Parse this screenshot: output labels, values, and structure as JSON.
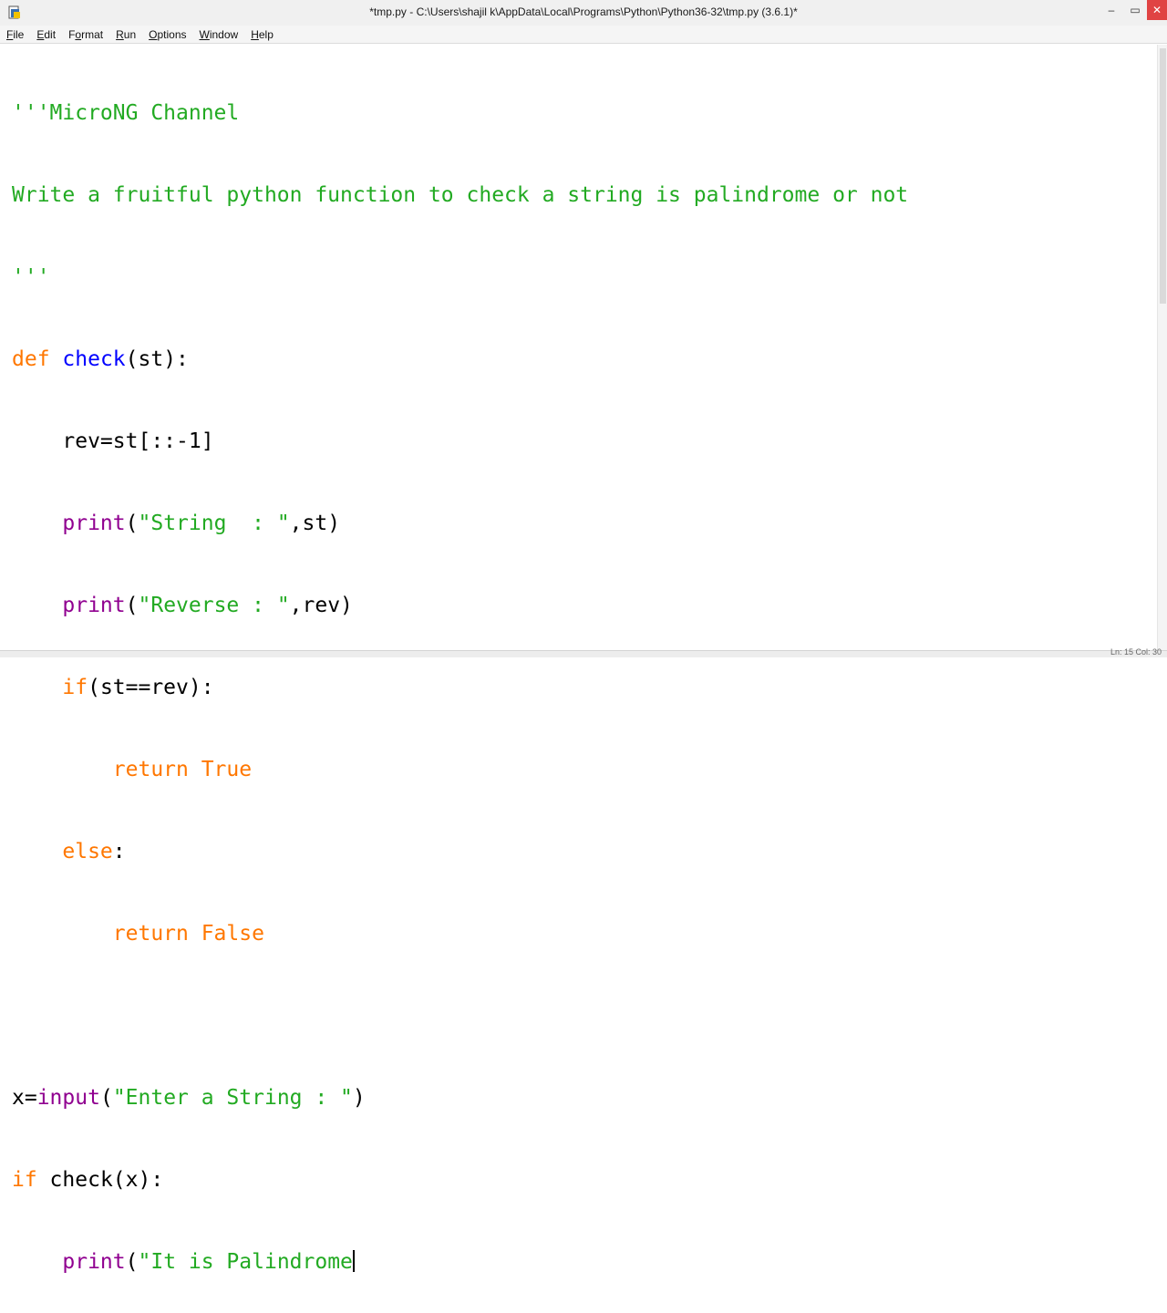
{
  "window": {
    "title": "*tmp.py - C:\\Users\\shajil k\\AppData\\Local\\Programs\\Python\\Python36-32\\tmp.py (3.6.1)*",
    "minimize": "–",
    "maximize": "▭",
    "close": "✕"
  },
  "menu": {
    "items": [
      {
        "accel": "F",
        "rest": "ile"
      },
      {
        "accel": "E",
        "rest": "dit"
      },
      {
        "accel": "",
        "rest": "Format",
        "pre": "F",
        "u": "o",
        "post": "rmat"
      },
      {
        "accel": "R",
        "rest": "un"
      },
      {
        "accel": "O",
        "rest": "ptions"
      },
      {
        "accel": "W",
        "rest": "indow"
      },
      {
        "accel": "H",
        "rest": "elp"
      }
    ],
    "labels": [
      "File",
      "Edit",
      "Format",
      "Run",
      "Options",
      "Window",
      "Help"
    ]
  },
  "code": {
    "l1": "'''MicroNG Channel",
    "l2": "Write a fruitful python function to check a string is palindrome or not",
    "l3": "'''",
    "l4_kw": "def",
    "l4_name": "check",
    "l4_rest": "(st):",
    "l5": "    rev=st[::-1]",
    "l6_ind": "    ",
    "l6_fn": "print",
    "l6_p1": "(",
    "l6_str": "\"String  : \"",
    "l6_p2": ",st)",
    "l7_ind": "    ",
    "l7_fn": "print",
    "l7_p1": "(",
    "l7_str": "\"Reverse : \"",
    "l7_p2": ",rev)",
    "l8_ind": "    ",
    "l8_kw": "if",
    "l8_rest": "(st==rev):",
    "l9_ind": "        ",
    "l9_kw": "return True",
    "l10_ind": "    ",
    "l10_kw": "else",
    "l10_rest": ":",
    "l11_ind": "        ",
    "l11_kw": "return False",
    "l12": "",
    "l13_pre": "x=",
    "l13_fn": "input",
    "l13_p1": "(",
    "l13_str": "\"Enter a String : \"",
    "l13_p2": ")",
    "l14_kw": "if",
    "l14_rest": " check(x):",
    "l15_ind": "    ",
    "l15_fn": "print",
    "l15_p1": "(",
    "l15_str": "\"It is Palindrome"
  },
  "status": {
    "text": "Ln: 15  Col: 30"
  },
  "colors": {
    "string": "#22aa22",
    "keyword": "#ff7700",
    "definition": "#0000ff",
    "builtin": "#900090"
  }
}
